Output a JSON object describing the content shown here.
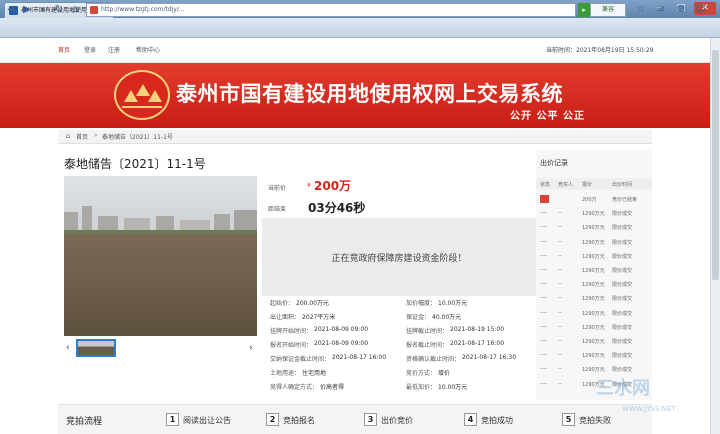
{
  "browser": {
    "tab_title": "泰州市国有建设用地使用权网上交易系统 - ...",
    "url": "http://www.tzgtj.com/tdjy/...",
    "mode_label": "兼容",
    "minimize": "–",
    "maximize": "□",
    "close": "✕",
    "new_tab": "+",
    "tab_close": "x"
  },
  "topbar": {
    "home": "首页",
    "login": "登录",
    "register": "注册",
    "help": "帮助中心",
    "time": "当前时间：2021年08月19日 15:50:29"
  },
  "banner": {
    "title": "泰州市国有建设用地使用权网上交易系统",
    "slogan": "公开  公平  公正",
    "colors": {
      "red": "#d62a1f",
      "gold": "#f5d27a"
    }
  },
  "breadcrumb": {
    "home": "首页",
    "separator": ">",
    "current": "泰地储告〔2021〕11-1号"
  },
  "lot": {
    "title": "泰地储告〔2021〕11-1号",
    "price_label": "当前价",
    "price_currency": "¥",
    "price_value": "200万",
    "countdown_label": "距结束",
    "countdown_value": "03分46秒",
    "stage_text": "正在竞政府保障房建设资金阶段！",
    "prev_icon": "‹",
    "next_icon": "›"
  },
  "details": [
    {
      "label": "起始价：",
      "value": "200.00万元"
    },
    {
      "label": "加价幅度：",
      "value": "10.00万元"
    },
    {
      "label": "出让面积：",
      "value": "2027平方米"
    },
    {
      "label": "保证金：",
      "value": "40.00万元"
    },
    {
      "label": "挂牌开始时间：",
      "value": "2021-08-09 09:00"
    },
    {
      "label": "挂牌截止时间：",
      "value": "2021-08-19 15:00"
    },
    {
      "label": "报名开始时间：",
      "value": "2021-08-09 09:00"
    },
    {
      "label": "报名截止时间：",
      "value": "2021-08-17 16:00"
    },
    {
      "label": "交纳保证金截止时间：",
      "value": "2021-08-17 16:00"
    },
    {
      "label": "资格确认截止时间：",
      "value": "2021-08-17 16:30"
    },
    {
      "label": "土地用途：",
      "value": "住宅用地"
    },
    {
      "label": "竞价方式：",
      "value": "增价"
    },
    {
      "label": "竞得人确定方式：",
      "value": "价高者得"
    },
    {
      "label": "最低加价：",
      "value": "10.00万元"
    }
  ],
  "records": {
    "title": "出价记录",
    "headers": [
      "状态",
      "竞买人",
      "报价",
      "出价时间"
    ],
    "rows": [
      [
        "",
        "",
        "200万",
        "竞价已结束"
      ],
      [
        "----",
        "--",
        "1290万元",
        "限价成交"
      ],
      [
        "----",
        "--",
        "1290万元",
        "限价成交"
      ],
      [
        "----",
        "--",
        "1290万元",
        "限价成交"
      ],
      [
        "----",
        "--",
        "1290万元",
        "限价成交"
      ],
      [
        "----",
        "--",
        "1290万元",
        "限价成交"
      ],
      [
        "----",
        "--",
        "1290万元",
        "限价成交"
      ],
      [
        "----",
        "--",
        "1290万元",
        "限价成交"
      ],
      [
        "----",
        "--",
        "1290万元",
        "限价成交"
      ],
      [
        "----",
        "--",
        "1290万元",
        "限价成交"
      ],
      [
        "----",
        "--",
        "1290万元",
        "限价成交"
      ],
      [
        "----",
        "--",
        "1290万元",
        "限价成交"
      ],
      [
        "----",
        "--",
        "1290万元",
        "限价成交"
      ],
      [
        "----",
        "--",
        "1290万元",
        "限价成交"
      ]
    ]
  },
  "process": {
    "title": "竞拍流程",
    "steps": [
      {
        "num": "1",
        "label": "阅读出让公告"
      },
      {
        "num": "2",
        "label": "竞拍报名"
      },
      {
        "num": "3",
        "label": "出价竞价"
      },
      {
        "num": "4",
        "label": "竞拍成功"
      },
      {
        "num": "5",
        "label": "竞拍失败"
      }
    ]
  },
  "watermark": {
    "main": "三水网",
    "sub": "WWW.JYSS.NET"
  }
}
